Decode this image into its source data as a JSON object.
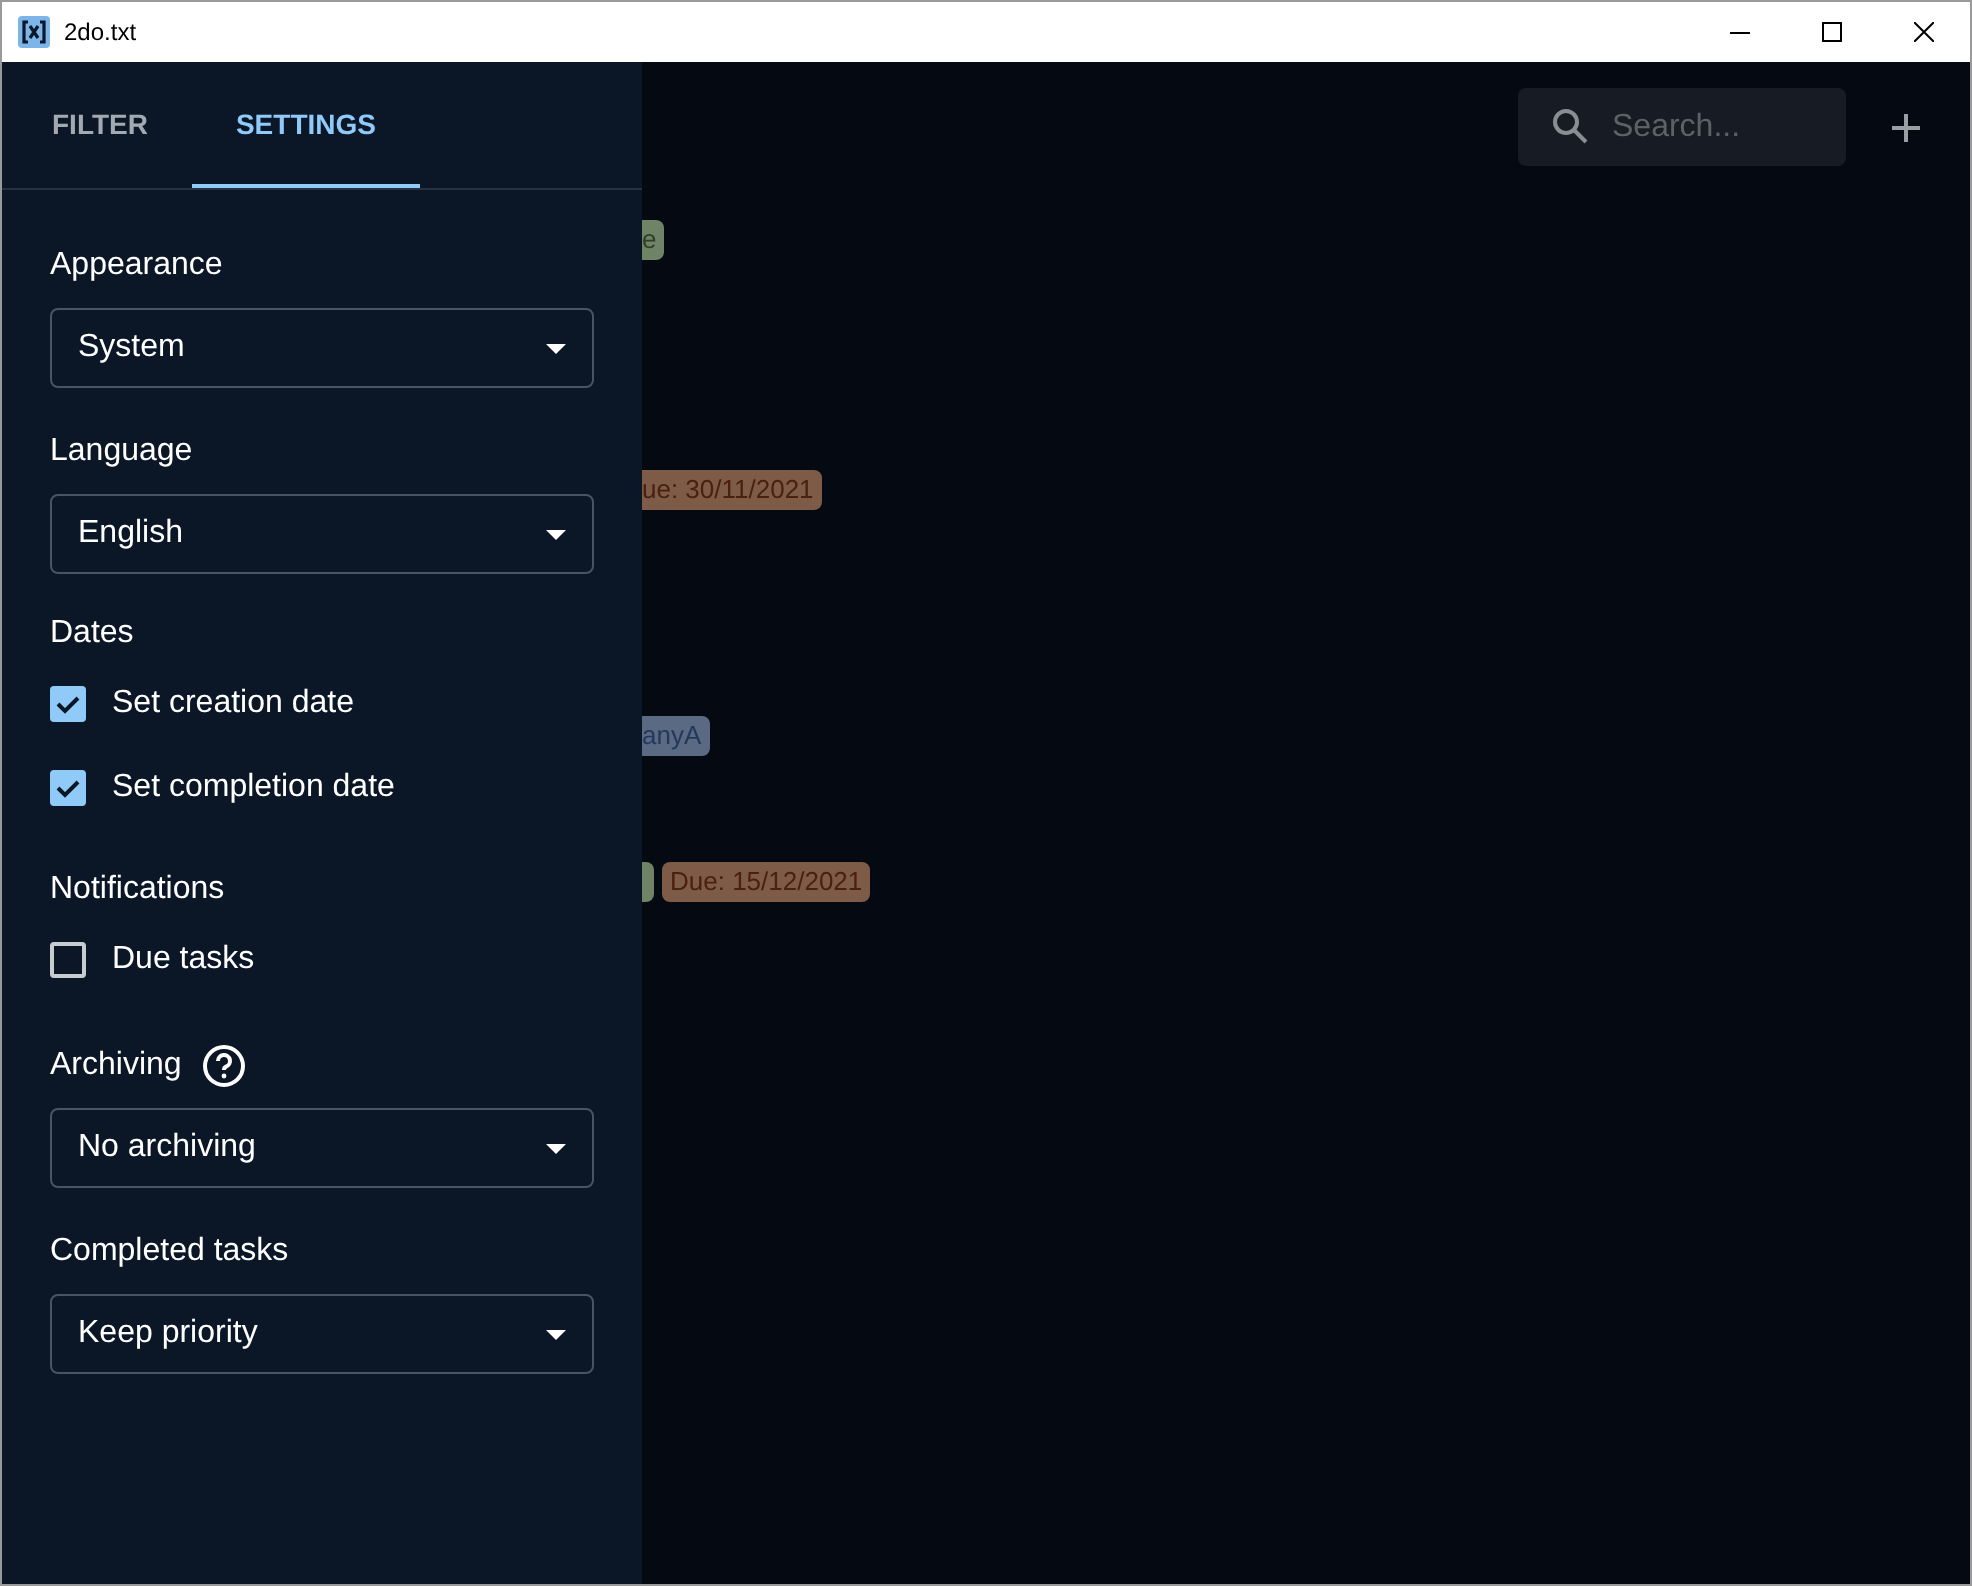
{
  "window": {
    "title": "2do.txt"
  },
  "tabs": [
    {
      "label": "FILTER",
      "selected": false
    },
    {
      "label": "SETTINGS",
      "selected": true
    }
  ],
  "settings": [
    {
      "kind": "select",
      "label": "Appearance",
      "value": "System"
    },
    {
      "kind": "select",
      "label": "Language",
      "value": "English"
    },
    {
      "kind": "checkboxes",
      "label": "Dates",
      "options": [
        {
          "label": "Set creation date",
          "checked": true
        },
        {
          "label": "Set completion date",
          "checked": true
        }
      ]
    },
    {
      "kind": "checkboxes",
      "label": "Notifications",
      "options": [
        {
          "label": "Due tasks",
          "checked": false
        }
      ]
    },
    {
      "kind": "select",
      "label": "Archiving",
      "help": true,
      "value": "No archiving"
    },
    {
      "kind": "select",
      "label": "Completed tasks",
      "value": "Keep priority"
    }
  ],
  "search": {
    "placeholder": "Search..."
  },
  "task_rows": [
    {
      "tags": [
        {
          "text": "e",
          "color": "#6f8466"
        }
      ]
    },
    {
      "tags": [
        {
          "text": "ue: 30/11/2021",
          "color": "#7d5b47"
        }
      ]
    },
    {
      "tags": [
        {
          "text": "anyA",
          "color": "#5a6a83"
        }
      ]
    },
    {
      "tags": [
        {
          "color": "#6f8466"
        },
        {
          "text": "Due: 15/12/2021",
          "color": "#7d5b47"
        }
      ]
    }
  ]
}
